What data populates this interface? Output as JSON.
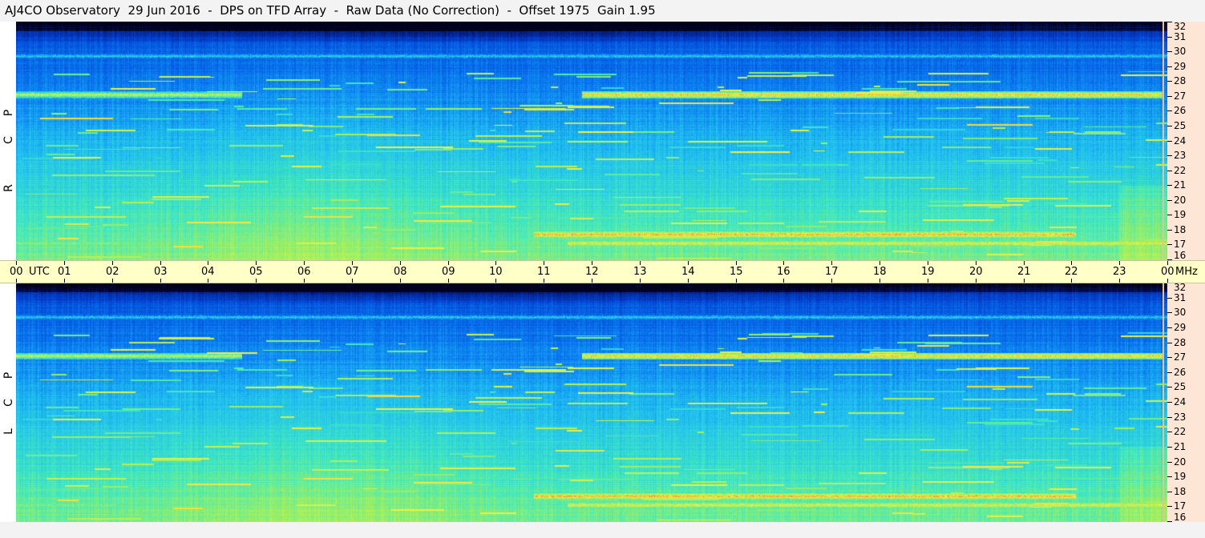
{
  "title": "AJ4CO Observatory  29 Jun 2016  -  DPS on TFD Array  -  Raw Data (No Correction)  -  Offset 1975  Gain 1.95",
  "panels": [
    {
      "name": "RCP",
      "letters": [
        "R",
        "C",
        "P"
      ]
    },
    {
      "name": "LCP",
      "letters": [
        "L",
        "C",
        "P"
      ]
    }
  ],
  "time_axis": {
    "labels": [
      "00",
      "UTC",
      "01",
      "02",
      "03",
      "04",
      "05",
      "06",
      "07",
      "08",
      "09",
      "10",
      "11",
      "12",
      "13",
      "14",
      "15",
      "16",
      "17",
      "18",
      "19",
      "20",
      "21",
      "22",
      "23",
      "00",
      "MHz"
    ]
  },
  "freq_axis": {
    "labels": [
      "32",
      "31",
      "30",
      "29",
      "28",
      "27",
      "26",
      "25",
      "24",
      "23",
      "22",
      "21",
      "20",
      "19",
      "18",
      "17",
      "16"
    ]
  },
  "colors": {
    "colormap": [
      "#000020",
      "#001a7a",
      "#0040d0",
      "#0a78f0",
      "#20c0f0",
      "#40e8c0",
      "#a0f060",
      "#f0f040",
      "#ff8030",
      "#ff3070"
    ],
    "time_axis_bg": "#ffffc8",
    "freq_axis_bg": "#fde6d6"
  },
  "chart_data": {
    "type": "heatmap",
    "title": "AJ4CO Observatory  29 Jun 2016  -  DPS on TFD Array  -  Raw Data (No Correction)  -  Offset 1975  Gain 1.95",
    "xlabel": "UTC",
    "ylabel": "MHz",
    "xlim": [
      0,
      24
    ],
    "ylim": [
      16,
      32
    ],
    "series": [
      {
        "name": "RCP"
      },
      {
        "name": "LCP"
      }
    ],
    "interference_bands_mhz": [
      {
        "freq": 27.1,
        "start_utc": 0.0,
        "end_utc": 4.7,
        "level": 0.72
      },
      {
        "freq": 27.1,
        "start_utc": 11.8,
        "end_utc": 23.9,
        "level": 0.82
      },
      {
        "freq": 29.7,
        "start_utc": 0.0,
        "end_utc": 24.0,
        "level": 0.48
      },
      {
        "freq": 17.7,
        "start_utc": 10.8,
        "end_utc": 22.1,
        "level": 0.85
      },
      {
        "freq": 17.1,
        "start_utc": 11.5,
        "end_utc": 24.0,
        "level": 0.78
      },
      {
        "freq": 17.1,
        "start_utc": 0.0,
        "end_utc": 2.1,
        "level": 0.65
      }
    ]
  }
}
